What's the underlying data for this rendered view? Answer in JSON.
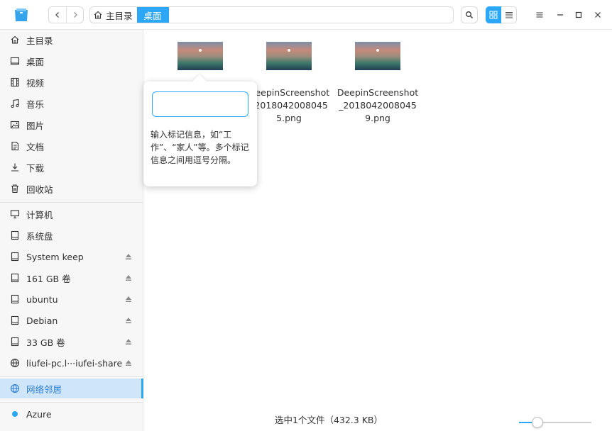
{
  "window": {
    "breadcrumb": [
      {
        "label": "主目录",
        "active": false
      },
      {
        "label": "桌面",
        "active": true
      }
    ]
  },
  "sidebar": {
    "items": [
      {
        "label": "主目录",
        "icon": "home-icon"
      },
      {
        "label": "桌面",
        "icon": "desktop-icon"
      },
      {
        "label": "视频",
        "icon": "video-icon"
      },
      {
        "label": "音乐",
        "icon": "music-icon"
      },
      {
        "label": "图片",
        "icon": "picture-icon"
      },
      {
        "label": "文档",
        "icon": "document-icon"
      },
      {
        "label": "下载",
        "icon": "download-icon"
      },
      {
        "label": "回收站",
        "icon": "trash-icon"
      }
    ],
    "devices": [
      {
        "label": "计算机",
        "icon": "computer-icon",
        "eject": false
      },
      {
        "label": "系统盘",
        "icon": "disk-icon",
        "eject": false
      },
      {
        "label": "System keep",
        "icon": "disk-icon",
        "eject": true
      },
      {
        "label": "161 GB 卷",
        "icon": "disk-icon",
        "eject": true
      },
      {
        "label": "ubuntu",
        "icon": "disk-icon",
        "eject": true
      },
      {
        "label": "Debian",
        "icon": "disk-icon",
        "eject": true
      },
      {
        "label": "33 GB 卷",
        "icon": "disk-icon",
        "eject": true
      },
      {
        "label": "liufei-pc.l···iufei-share",
        "icon": "network-share-icon",
        "eject": true
      }
    ],
    "network": {
      "label": "网络邻居",
      "icon": "network-icon",
      "selected": true
    },
    "tags": [
      {
        "label": "Azure",
        "color": "#2ca7f8"
      }
    ]
  },
  "files": [
    {
      "name": ""
    },
    {
      "name": "DeepinScreenshot_20180420080455.png"
    },
    {
      "name": "DeepinScreenshot_20180420080459.png"
    }
  ],
  "tag_popover": {
    "placeholder": "",
    "hint": "输入标记信息，如“工作”、“家人”等。多个标记信息之间用逗号分隔。"
  },
  "status": {
    "text": "选中1个文件（432.3 KB）",
    "zoom_level": 0.2
  },
  "colors": {
    "accent": "#2ca7f8",
    "selected_bg": "#cfe6fa"
  }
}
